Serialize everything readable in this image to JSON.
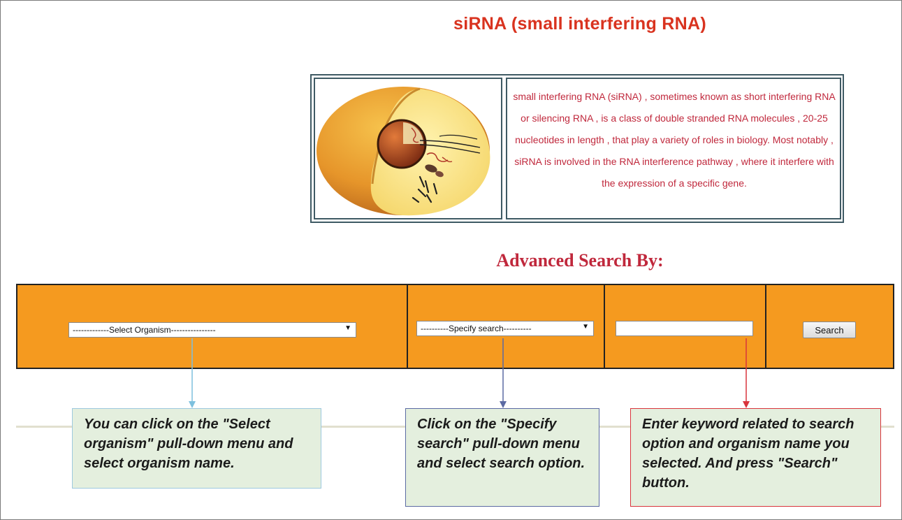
{
  "page_title": "siRNA (small interfering RNA)",
  "description": "small interfering RNA (siRNA) , sometimes known as short interfering RNA or silencing RNA , is a class of double stranded RNA molecules , 20-25 nucleotides in length , that play a variety of roles in biology. Most notably , siRNA is involved in the RNA interference pathway , where it interfere with the expression of a specific gene.",
  "advanced_search_title": "Advanced Search By:",
  "search_bar": {
    "organism_select": "-------------Select Organism----------------",
    "specify_select": "----------Specify search----------",
    "keyword_value": "",
    "search_label": "Search"
  },
  "callouts": [
    "You can click on the \"Select organism\" pull-down menu and select organism name.",
    "Click on the \"Specify search\" pull-down menu and select search option.",
    "Enter keyword related to search option and organism name you selected. And press \"Search\" button."
  ],
  "colors": {
    "title_red": "#d9331f",
    "text_crimson": "#c0283c",
    "bar_orange": "#f59a1f",
    "callout_bg": "#e4efde",
    "arrow_blue": "#7dc0de",
    "arrow_indigo": "#5b6aa3",
    "arrow_red": "#d9343c"
  }
}
